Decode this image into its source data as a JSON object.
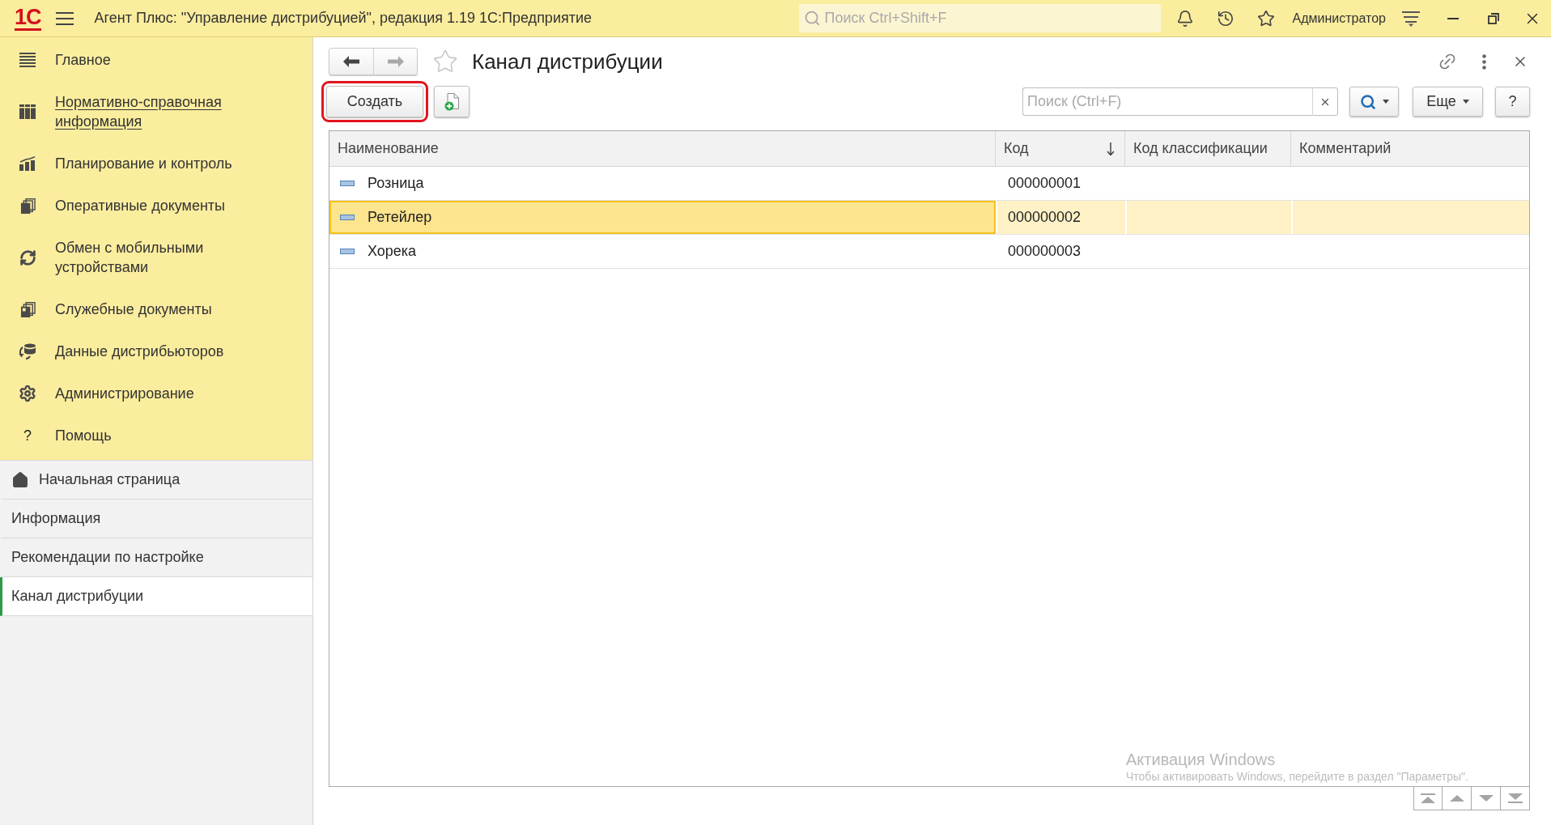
{
  "title_bar": {
    "logo": "1С",
    "title": "Агент Плюс: \"Управление дистрибуцией\", редакция 1.19 1С:Предприятие",
    "search": {
      "placeholder": "Поиск Ctrl+Shift+F"
    },
    "user": "Администратор"
  },
  "sidebar": {
    "sections": [
      {
        "label": "Главное",
        "hovered": false
      },
      {
        "label": "Нормативно-справочная информация",
        "hovered": true
      },
      {
        "label": "Планирование и контроль",
        "hovered": false
      },
      {
        "label": "Оперативные документы",
        "hovered": false
      },
      {
        "label": "Обмен с мобильными устройствами",
        "hovered": false
      },
      {
        "label": "Служебные документы",
        "hovered": false
      },
      {
        "label": "Данные дистрибьюторов",
        "hovered": false
      },
      {
        "label": "Администрирование",
        "hovered": false
      },
      {
        "label": "Помощь",
        "hovered": false,
        "glyph": "?"
      }
    ],
    "open_windows": [
      {
        "kind": "home",
        "label": "Начальная страница",
        "selected": false
      },
      {
        "kind": "form",
        "label": "Информация",
        "selected": false
      },
      {
        "kind": "form",
        "label": "Рекомендации по настройке",
        "selected": false
      },
      {
        "kind": "form",
        "label": "Канал дистрибуции",
        "selected": true
      }
    ]
  },
  "form": {
    "nav_buttons": [
      {
        "kind": "back",
        "disabled": false
      },
      {
        "kind": "forward",
        "disabled": true
      }
    ],
    "favorite": false,
    "title": "Канал дистрибуции",
    "toolbar": {
      "create_button": {
        "label": "Создать",
        "highlighted": true
      },
      "search": {
        "placeholder": "Поиск (Ctrl+F)"
      },
      "more_button": "Еще",
      "help_button": "?"
    },
    "table": {
      "columns": [
        {
          "label": "Наименование",
          "sorted": false
        },
        {
          "label": "Код",
          "sorted": true
        },
        {
          "label": "Код классификации",
          "sorted": false
        },
        {
          "label": "Комментарий",
          "sorted": false
        }
      ],
      "rows": [
        {
          "name": "Розница",
          "code": "000000001",
          "selected": false
        },
        {
          "name": "Ретейлер",
          "code": "000000002",
          "selected": true
        },
        {
          "name": "Хорека",
          "code": "000000003",
          "selected": false
        }
      ]
    }
  },
  "os_notice": {
    "title": "Активация Windows",
    "text": "Чтобы активировать Windows, перейдите в раздел \"Параметры\"."
  }
}
